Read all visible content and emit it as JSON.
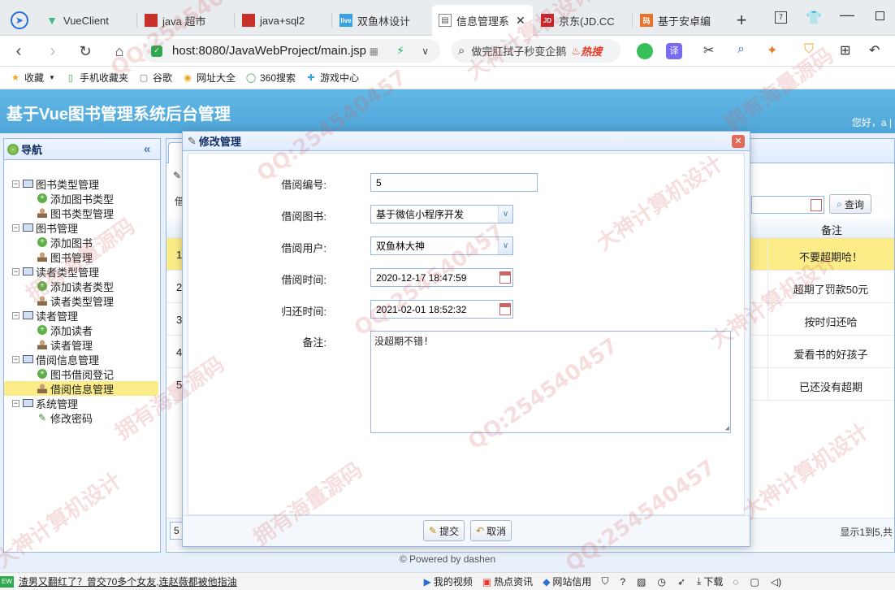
{
  "browser": {
    "tabs": [
      {
        "label": "VueClient",
        "icon": "vue-logo"
      },
      {
        "label": "java 超市",
        "icon": "red-square"
      },
      {
        "label": "java+sql2",
        "icon": "red-square"
      },
      {
        "label": "双鱼林设计",
        "icon": "live-icon"
      },
      {
        "label": "信息管理系",
        "icon": "page-icon",
        "active": true
      },
      {
        "label": "京东(JD.CC",
        "icon": "jd-icon"
      },
      {
        "label": "基于安卓编",
        "icon": "orange-icon"
      }
    ],
    "new_tab": "+",
    "url": "host:8080/JavaWebProject/main.jsp",
    "search_text": "做完肛拭子秒变企鹅",
    "search_hot": "热搜",
    "bookmarks": [
      "收藏",
      "手机收藏夹",
      "谷歌",
      "网址大全",
      "360搜索",
      "游戏中心"
    ]
  },
  "app": {
    "title": "基于Vue图书管理系统后台管理",
    "greeting": "您好，a |",
    "nav_title": "导航",
    "tree": [
      {
        "label": "图书类型管理",
        "level": 0
      },
      {
        "label": "添加图书类型",
        "level": 1,
        "icon": "add"
      },
      {
        "label": "图书类型管理",
        "level": 1,
        "icon": "user"
      },
      {
        "label": "图书管理",
        "level": 0
      },
      {
        "label": "添加图书",
        "level": 1,
        "icon": "add"
      },
      {
        "label": "图书管理",
        "level": 1,
        "icon": "user"
      },
      {
        "label": "读者类型管理",
        "level": 0
      },
      {
        "label": "添加读者类型",
        "level": 1,
        "icon": "add"
      },
      {
        "label": "读者类型管理",
        "level": 1,
        "icon": "user"
      },
      {
        "label": "读者管理",
        "level": 0
      },
      {
        "label": "添加读者",
        "level": 1,
        "icon": "add"
      },
      {
        "label": "读者管理",
        "level": 1,
        "icon": "user"
      },
      {
        "label": "借阅信息管理",
        "level": 0
      },
      {
        "label": "图书借阅登记",
        "level": 1,
        "icon": "add"
      },
      {
        "label": "借阅信息管理",
        "level": 1,
        "icon": "user",
        "selected": true
      },
      {
        "label": "系统管理",
        "level": 0
      },
      {
        "label": "修改密码",
        "level": 1,
        "icon": "pencil"
      }
    ],
    "grid": {
      "query_label": "查询",
      "remark_header": "备注",
      "row_numbers": [
        "1",
        "2",
        "3",
        "4",
        "5"
      ],
      "remarks": [
        "不要超期哈！",
        "超期了罚款50元",
        "按时归还哈",
        "爱看书的好孩子",
        "已还没有超期"
      ],
      "pager_size": "5",
      "pager_info": "显示1到5,共"
    },
    "footer": "© Powered by dashen"
  },
  "dialog": {
    "title": "修改管理",
    "fields": [
      {
        "label": "借阅编号:",
        "value": "5",
        "type": "text"
      },
      {
        "label": "借阅图书:",
        "value": "基于微信小程序开发",
        "type": "combo"
      },
      {
        "label": "借阅用户:",
        "value": "双鱼林大神",
        "type": "combo"
      },
      {
        "label": "借阅时间:",
        "value": "2020-12-17 18:47:59",
        "type": "date"
      },
      {
        "label": "归还时间:",
        "value": "2021-02-01 18:52:32",
        "type": "date"
      }
    ],
    "remark_label": "备注:",
    "remark_value": "没超期不错!",
    "submit_label": "提交",
    "cancel_label": "取消"
  },
  "statusbar": {
    "news": "渣男又翻红了？曾交70多个女友,连赵薇都被他指油",
    "items": [
      "我的视频",
      "热点资讯",
      "网站信用",
      "下载"
    ]
  },
  "watermark": {
    "lines": [
      "QQ:254540457",
      "大神计算机设计",
      "拥有海量源码"
    ]
  }
}
